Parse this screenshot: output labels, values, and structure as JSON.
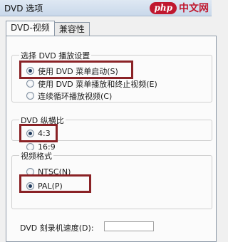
{
  "window": {
    "title": "DVD 选项",
    "watermark_badge": "php",
    "watermark_text": "中文网"
  },
  "tabs": [
    {
      "label": "DVD-视频",
      "active": true
    },
    {
      "label": "兼容性",
      "active": false
    }
  ],
  "playback_group": {
    "legend": "选择 DVD 播放设置",
    "options": [
      {
        "label": "使用 DVD 菜单启动(S)",
        "checked": true
      },
      {
        "label": "使用 DVD 菜单播放和终止视频(E)",
        "checked": false
      },
      {
        "label": "连续循环播放视频(C)",
        "checked": false
      }
    ]
  },
  "aspect_group": {
    "legend": "DVD 纵横比",
    "options": [
      {
        "label": "4:3",
        "checked": true
      },
      {
        "label": "16:9",
        "checked": false
      }
    ]
  },
  "format_group": {
    "legend": "视频格式",
    "options": [
      {
        "label": "NTSC(N)",
        "checked": false
      },
      {
        "label": "PAL(P)",
        "checked": true
      }
    ]
  },
  "bottom": {
    "label": "DVD 刻录机速度(D):"
  }
}
